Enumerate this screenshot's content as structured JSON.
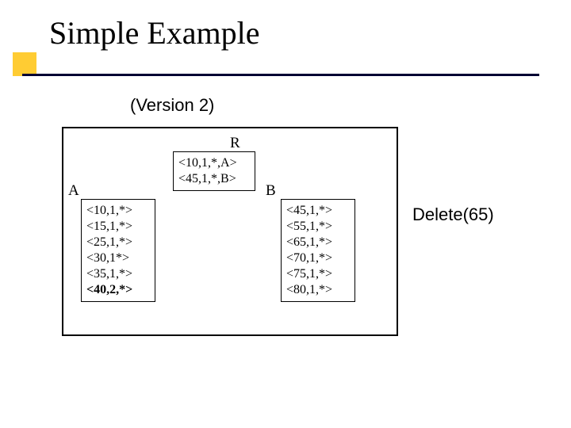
{
  "title": "Simple Example",
  "subtitle": "(Version 2)",
  "operation": "Delete(65)",
  "labels": {
    "R": "R",
    "A": "A",
    "B": "B"
  },
  "nodes": {
    "R": [
      {
        "text": "<10,1,*,A>",
        "bold": false
      },
      {
        "text": "<45,1,*,B>",
        "bold": false
      }
    ],
    "A": [
      {
        "text": "<10,1,*>",
        "bold": false
      },
      {
        "text": "<15,1,*>",
        "bold": false
      },
      {
        "text": "<25,1,*>",
        "bold": false
      },
      {
        "text": "<30,1*>",
        "bold": false
      },
      {
        "text": "<35,1,*>",
        "bold": false
      },
      {
        "text": "<40,2,*>",
        "bold": true
      }
    ],
    "B": [
      {
        "text": "<45,1,*>",
        "bold": false
      },
      {
        "text": "<55,1,*>",
        "bold": false
      },
      {
        "text": "<65,1,*>",
        "bold": false
      },
      {
        "text": "<70,1,*>",
        "bold": false
      },
      {
        "text": "<75,1,*>",
        "bold": false
      },
      {
        "text": "<80,1,*>",
        "bold": false
      }
    ]
  }
}
